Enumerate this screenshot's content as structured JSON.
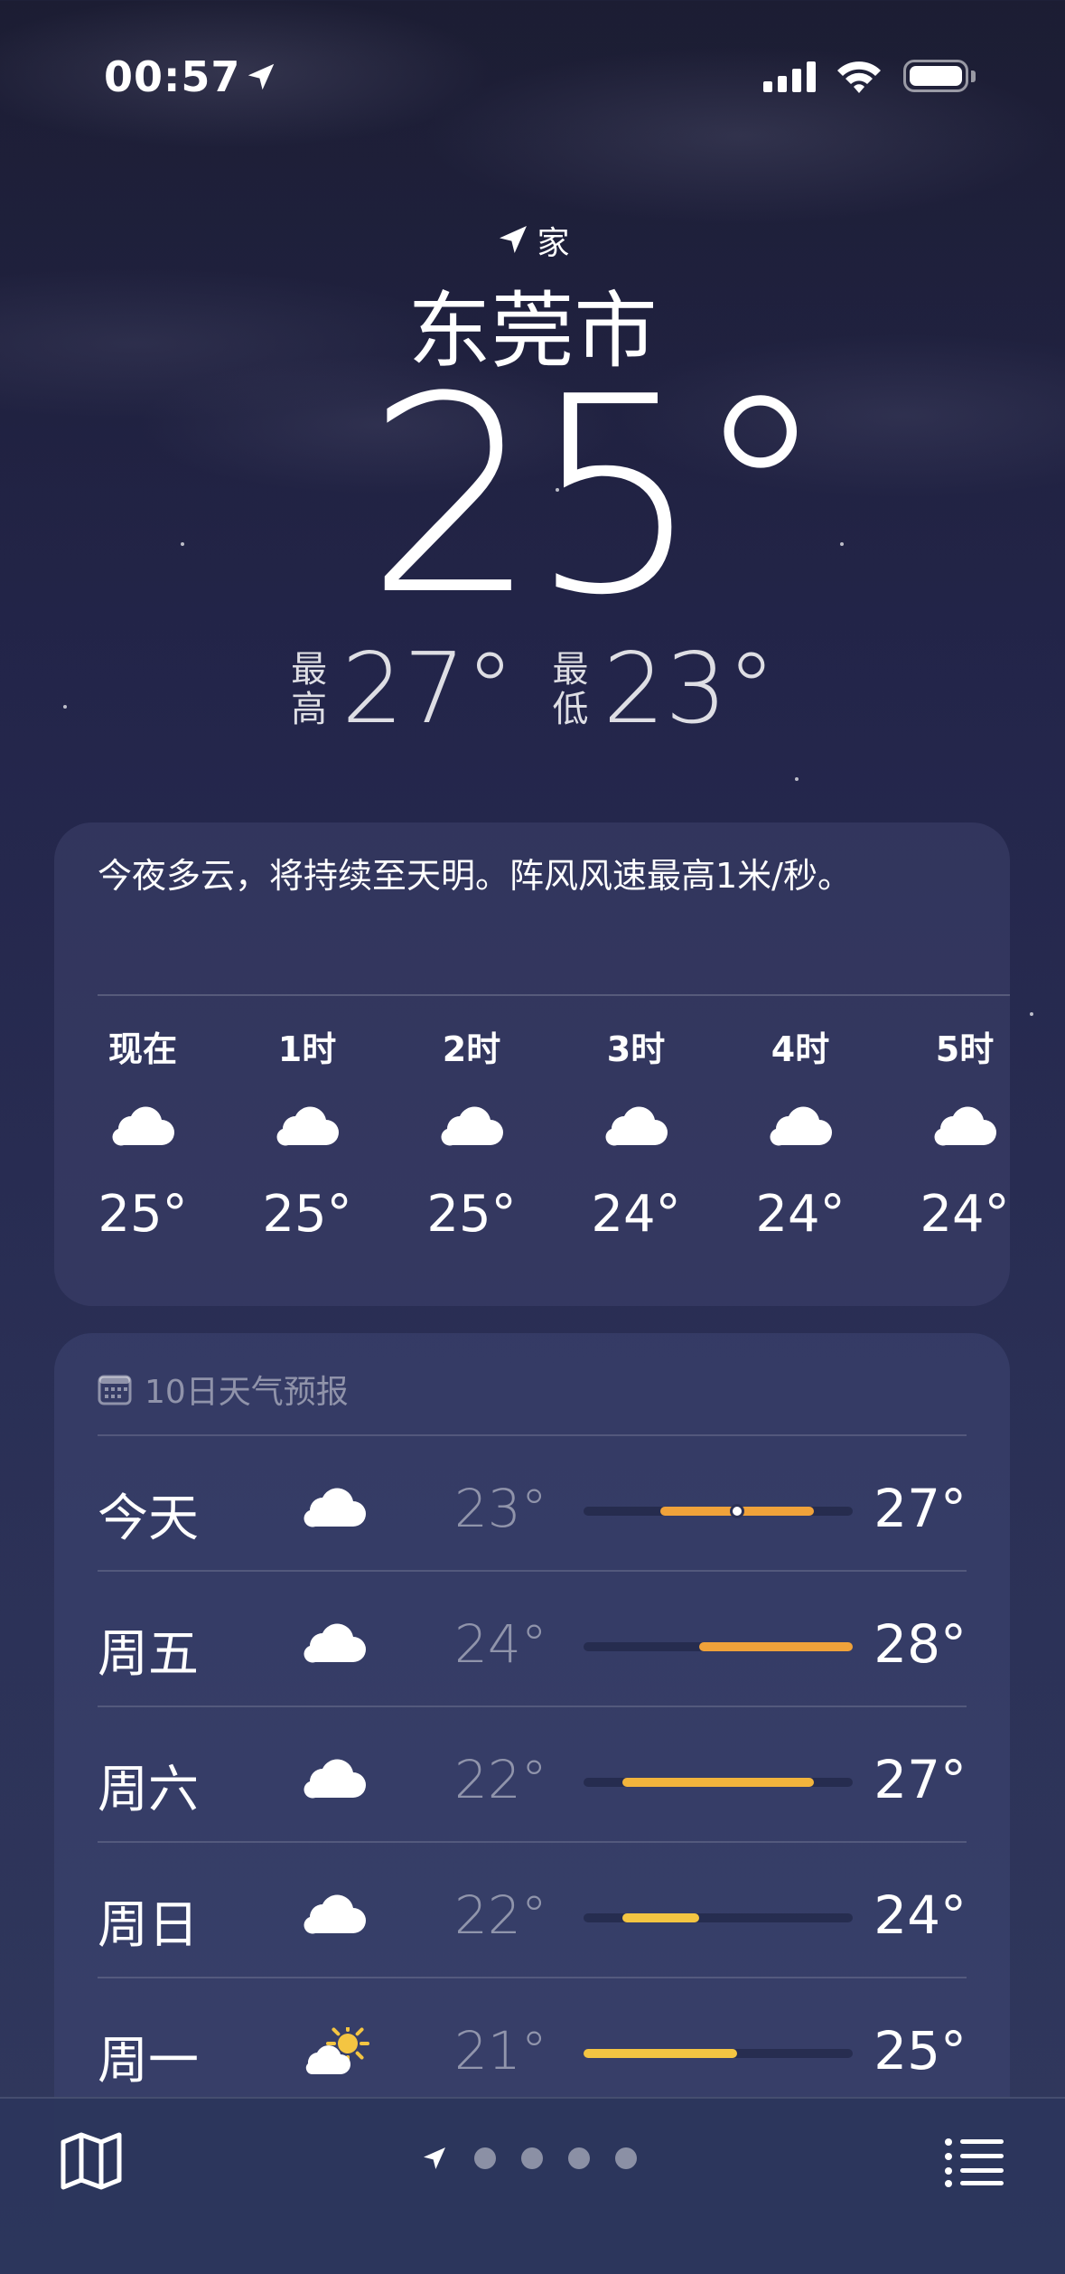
{
  "status_bar": {
    "time": "00:57"
  },
  "location": {
    "home_label": "家",
    "city": "东莞市",
    "current_temp": "25°",
    "high_label": "最高",
    "high": "27°",
    "low_label": "最低",
    "low": "23°"
  },
  "hourly": {
    "summary": "今夜多云，将持续至天明。阵风风速最高1米/秒。",
    "items": [
      {
        "hour": "现在",
        "icon": "cloud-icon",
        "temp": "25°"
      },
      {
        "hour": "1时",
        "icon": "cloud-icon",
        "temp": "25°"
      },
      {
        "hour": "2时",
        "icon": "cloud-icon",
        "temp": "25°"
      },
      {
        "hour": "3时",
        "icon": "cloud-icon",
        "temp": "24°"
      },
      {
        "hour": "4时",
        "icon": "cloud-icon",
        "temp": "24°"
      },
      {
        "hour": "5时",
        "icon": "cloud-icon",
        "temp": "24°"
      }
    ]
  },
  "daily": {
    "title": "10日天气预报",
    "range": [
      21,
      28
    ],
    "items": [
      {
        "day": "今天",
        "icon": "cloud-icon",
        "low": "23°",
        "high": "27°",
        "low_val": 23,
        "high_val": 27,
        "current": 25,
        "color": "#f0a23a"
      },
      {
        "day": "周五",
        "icon": "cloud-icon",
        "low": "24°",
        "high": "28°",
        "low_val": 24,
        "high_val": 28,
        "color": "#f0a23a"
      },
      {
        "day": "周六",
        "icon": "cloud-icon",
        "low": "22°",
        "high": "27°",
        "low_val": 22,
        "high_val": 27,
        "color": "#f2b43c"
      },
      {
        "day": "周日",
        "icon": "cloud-icon",
        "low": "22°",
        "high": "24°",
        "low_val": 22,
        "high_val": 24,
        "color": "#f4c542"
      },
      {
        "day": "周一",
        "icon": "partly-sunny-icon",
        "low": "21°",
        "high": "25°",
        "low_val": 21,
        "high_val": 25,
        "color": "#f4c542"
      }
    ]
  },
  "toolbar": {
    "pages": 4,
    "active": "location-arrow-icon"
  }
}
